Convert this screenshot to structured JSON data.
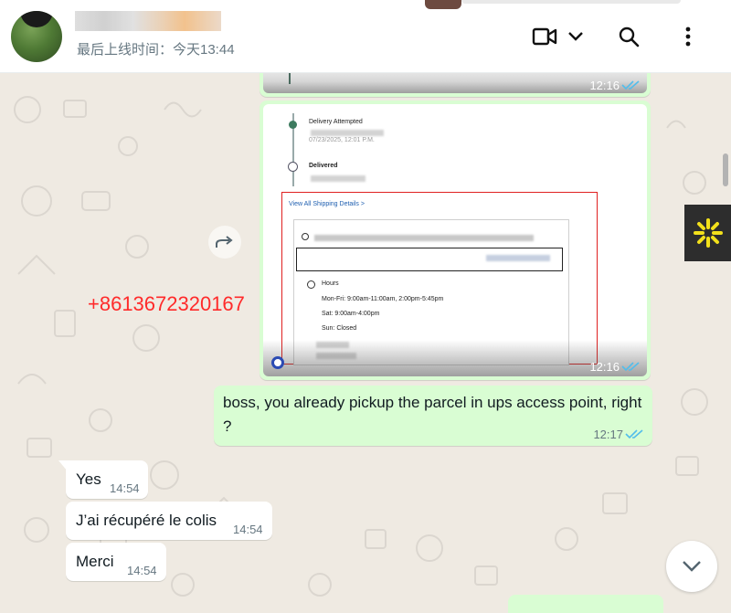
{
  "header": {
    "contact_name": "█ ▌ ██ ▄█ ▌█",
    "last_seen": "最后上线时间：今天13:44",
    "icons": [
      "video-call-icon",
      "chevron-down-icon",
      "search-icon",
      "menu-icon"
    ]
  },
  "messages": {
    "img1_time": "12:16",
    "img2_time": "12:16",
    "img2": {
      "delivered_label": "Delivered",
      "attempt_label": "Delivery Attempted",
      "date1": "07/23/2025, 12:01 P.M.",
      "link": "View All Shipping Details >",
      "hours_label": "Hours",
      "hours_weekday": "Mon-Fri: 9:00am-11:00am, 2:00pm-5:45pm",
      "hours_sat": "Sat: 9:00am-4:00pm",
      "hours_sun": "Sun: Closed"
    },
    "overlay_phone": "+8613672320167",
    "out_text": "boss, you already pickup the parcel in ups access point, right ?",
    "out_time": "12:17",
    "in1_text": "Yes",
    "in1_time": "14:54",
    "in2_text": "J’ai récupéré le colis",
    "in2_time": "14:54",
    "in3_text": "Merci",
    "in3_time": "14:54"
  },
  "colors": {
    "outgoing_bubble": "#d9fdd3",
    "incoming_bubble": "#ffffff",
    "read_tick": "#53bdeb",
    "background": "#efeae2",
    "annotation_red": "#ff2a2a"
  }
}
